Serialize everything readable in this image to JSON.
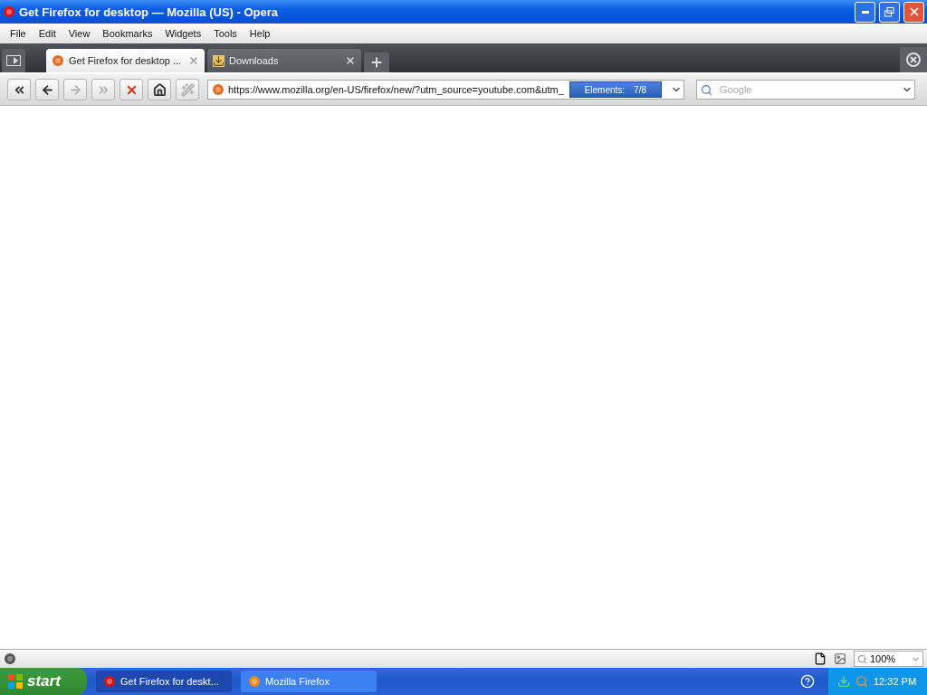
{
  "window": {
    "title": "Get Firefox for desktop — Mozilla (US) - Opera"
  },
  "menu": [
    "File",
    "Edit",
    "View",
    "Bookmarks",
    "Widgets",
    "Tools",
    "Help"
  ],
  "tabs": [
    {
      "label": "Get Firefox for desktop ...",
      "selected": true,
      "kind": "firefox"
    },
    {
      "label": "Downloads",
      "selected": false,
      "kind": "downloads"
    }
  ],
  "toolbar_buttons": [
    {
      "kind": "rewind",
      "disabled": false
    },
    {
      "kind": "back",
      "disabled": false
    },
    {
      "kind": "forward",
      "disabled": true
    },
    {
      "kind": "fast-forward",
      "disabled": true
    },
    {
      "kind": "stop",
      "disabled": false
    },
    {
      "kind": "home",
      "disabled": false
    },
    {
      "kind": "wand",
      "disabled": true
    }
  ],
  "address": {
    "value": "https://www.mozilla.org/en-US/firefox/new/?utm_source=youtube.com&utm_",
    "elements_label": "Elements:",
    "elements_count": "7/8"
  },
  "search": {
    "placeholder": "Google"
  },
  "status_bar": {
    "zoom": "100%"
  },
  "taskbar": {
    "start": "start",
    "tasks": [
      {
        "label": "Get Firefox for deskt...",
        "selected": true,
        "kind": "opera"
      },
      {
        "label": "Mozilla Firefox",
        "selected": false,
        "kind": "firefox"
      }
    ],
    "clock": "12:32 PM"
  }
}
